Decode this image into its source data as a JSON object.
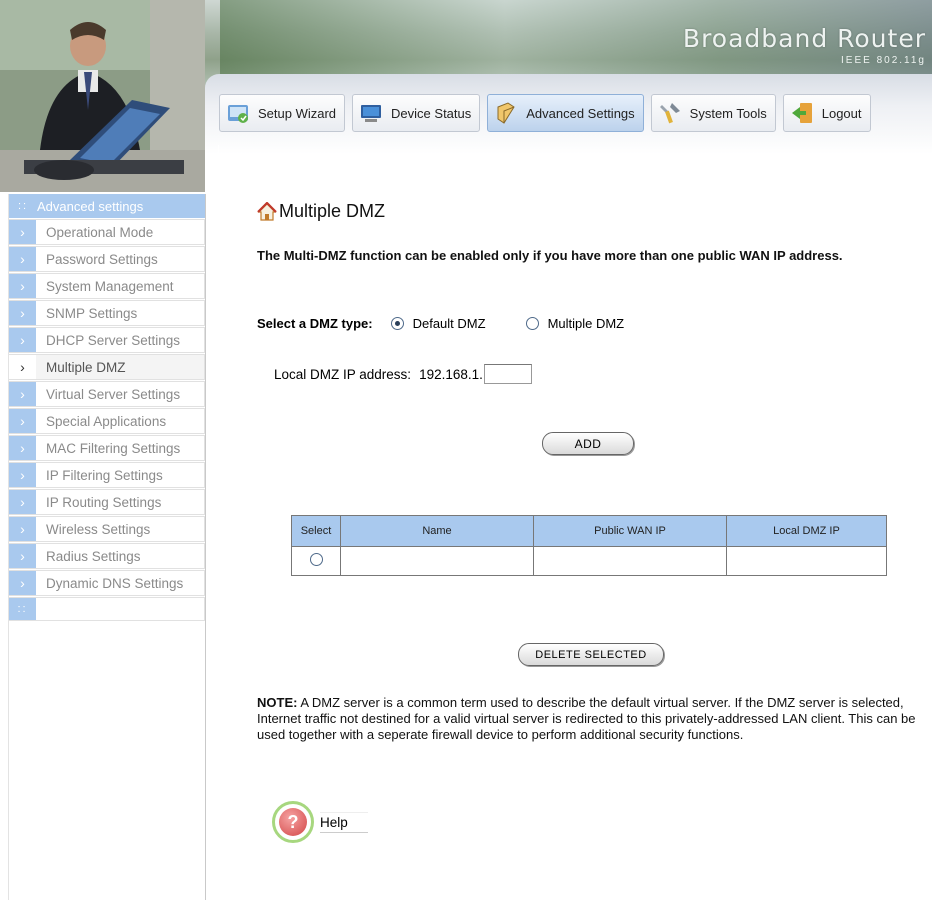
{
  "brand": {
    "title": "Broadband Router",
    "subtitle": "IEEE 802.11g"
  },
  "tabs": [
    {
      "label": "Setup Wizard",
      "icon": "wizard-icon"
    },
    {
      "label": "Device Status",
      "icon": "monitor-icon"
    },
    {
      "label": "Advanced Settings",
      "icon": "book-icon",
      "active": true
    },
    {
      "label": "System Tools",
      "icon": "tools-icon"
    },
    {
      "label": "Logout",
      "icon": "logout-icon"
    }
  ],
  "sidebar": {
    "header": "Advanced settings",
    "items": [
      {
        "label": "Operational Mode"
      },
      {
        "label": "Password Settings"
      },
      {
        "label": "System Management"
      },
      {
        "label": "SNMP Settings"
      },
      {
        "label": "DHCP Server Settings"
      },
      {
        "label": "Multiple DMZ",
        "active": true
      },
      {
        "label": "Virtual Server Settings"
      },
      {
        "label": "Special Applications"
      },
      {
        "label": "MAC Filtering Settings"
      },
      {
        "label": "IP Filtering Settings"
      },
      {
        "label": "IP Routing Settings"
      },
      {
        "label": "Wireless Settings"
      },
      {
        "label": "Radius Settings"
      },
      {
        "label": "Dynamic DNS Settings"
      }
    ]
  },
  "main": {
    "title": "Multiple DMZ",
    "intro": "The Multi-DMZ function can be enabled only if you have more than one public WAN IP address.",
    "dmz_type_label": "Select a DMZ type:",
    "dmz_options": [
      {
        "label": "Default DMZ",
        "selected": true
      },
      {
        "label": "Multiple DMZ",
        "selected": false
      }
    ],
    "local_ip_label": "Local DMZ IP address:",
    "local_ip_prefix": "192.168.1.",
    "local_ip_value": "",
    "add_button": "ADD",
    "table": {
      "headers": [
        "Select",
        "Name",
        "Public WAN IP",
        "Local DMZ IP"
      ],
      "rows": [
        {
          "name": "",
          "public_wan_ip": "",
          "local_dmz_ip": ""
        }
      ]
    },
    "delete_button": "DELETE SELECTED",
    "note_prefix": "NOTE:",
    "note_text": " A DMZ server is a common term used to describe the default virtual server. If the DMZ server is selected, Internet traffic not destined for a valid virtual server is redirected to this privately-addressed LAN client. This can be used together with a seperate firewall device to perform additional security functions.",
    "help_label": "Help"
  }
}
